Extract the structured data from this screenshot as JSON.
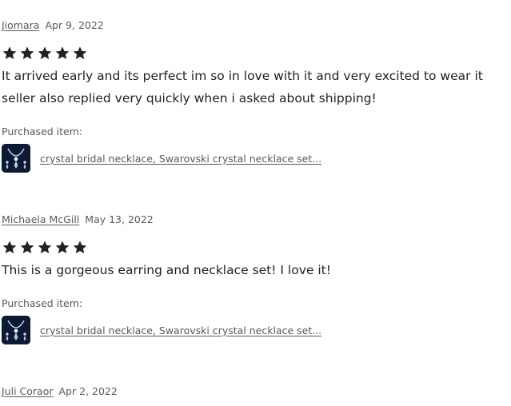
{
  "reviews": [
    {
      "author": "Jiomara",
      "date": "Apr 9, 2022",
      "rating": 5,
      "text": "It arrived early and its perfect im so in love with it and very excited to wear it seller also replied very quickly when i asked about shipping!",
      "purchased_label": "Purchased item:",
      "item_title": "crystal bridal necklace, Swarovski crystal necklace set..."
    },
    {
      "author": "Michaela McGill",
      "date": "May 13, 2022",
      "rating": 5,
      "text": "This is a gorgeous earring and necklace set! I love it!",
      "purchased_label": "Purchased item:",
      "item_title": "crystal bridal necklace, Swarovski crystal necklace set..."
    },
    {
      "author": "Juli Coraor",
      "date": "Apr 2, 2022"
    }
  ],
  "icons": {
    "star": "star-icon",
    "thumbnail": "necklace-thumbnail"
  },
  "colors": {
    "star": "#222222",
    "muted": "#595959",
    "thumb_bg": "#0d1a33"
  }
}
